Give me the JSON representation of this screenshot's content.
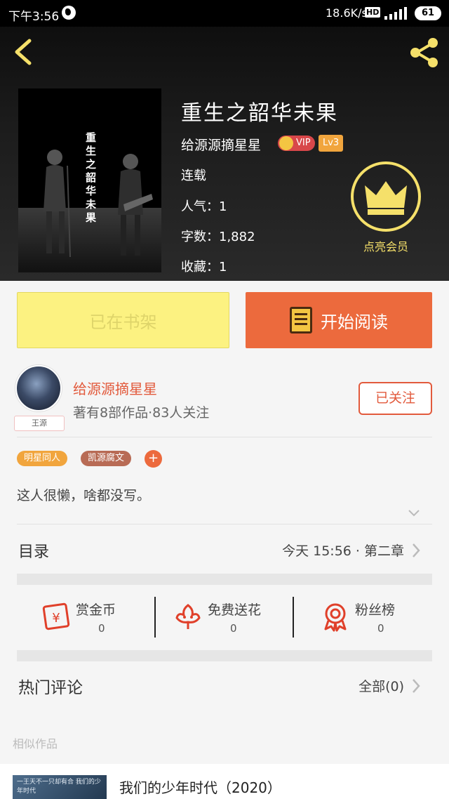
{
  "status_bar": {
    "time": "下午3:56",
    "net_speed": "18.6K/s",
    "hd": "HD",
    "battery": "61"
  },
  "book": {
    "title": "重生之韶华未果",
    "cover_title": "重生之韶华未果",
    "author": "给源源摘星星",
    "vip_label": "VIP",
    "level": "Lv3",
    "status": "连载",
    "popularity": "人气：1",
    "words": "字数：1,882",
    "favorites": "收藏：1"
  },
  "vip_member": {
    "label": "点亮会员"
  },
  "actions": {
    "shelf_label": "已在书架",
    "read_label": "开始阅读"
  },
  "author_card": {
    "avatar_tag": "王源",
    "name": "给源源摘星星",
    "stats": "著有8部作品·83人关注",
    "follow_label": "已关注"
  },
  "tags": [
    "明星同人",
    "凯源腐文"
  ],
  "tag_add": "+",
  "bio": "这人很懒，啥都没写。",
  "toc": {
    "label": "目录",
    "update": "今天 15:56 · 第二章"
  },
  "rewards": [
    {
      "label": "赏金币",
      "count": "0",
      "icon": "gold-coin-icon"
    },
    {
      "label": "免费送花",
      "count": "0",
      "icon": "flower-icon"
    },
    {
      "label": "粉丝榜",
      "count": "0",
      "icon": "medal-icon"
    }
  ],
  "comments": {
    "label": "热门评论",
    "all": "全部(0)"
  },
  "similar": {
    "label": "相似作品",
    "items": [
      {
        "title": "我们的少年时代（2020）",
        "thumb_text": "一王天不一只却有合 我们的少年时代"
      }
    ]
  },
  "colors": {
    "accent_orange": "#ec6a3d",
    "shelf_yellow": "#fcf281",
    "vip_gold": "#f5e06a",
    "author_red": "#e25a3c"
  }
}
